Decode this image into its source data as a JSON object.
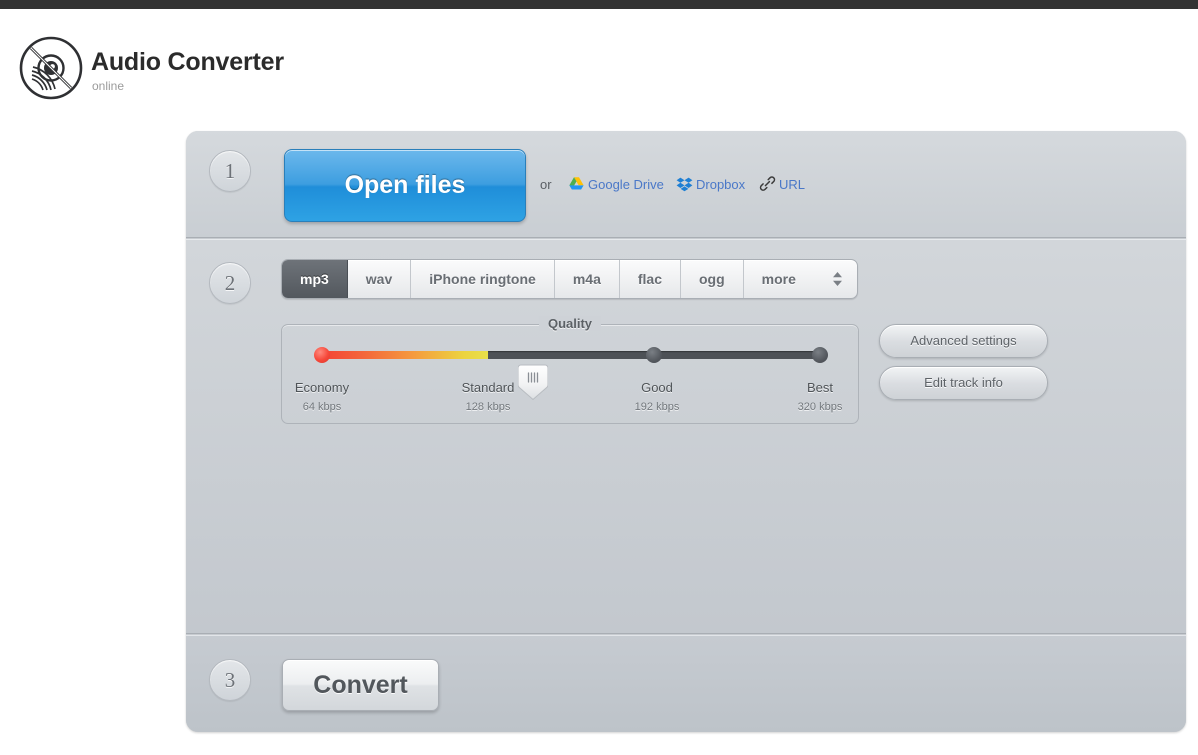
{
  "header": {
    "title": "Audio Converter",
    "subtitle": "online",
    "logo_icon": "vinyl-record-icon"
  },
  "steps": {
    "one": "1",
    "two": "2",
    "three": "3"
  },
  "step1": {
    "open_files_label": "Open files",
    "or_label": "or",
    "sources": [
      {
        "label": "Google Drive",
        "icon": "google-drive-icon"
      },
      {
        "label": "Dropbox",
        "icon": "dropbox-icon"
      },
      {
        "label": "URL",
        "icon": "link-chain-icon"
      }
    ]
  },
  "step2": {
    "formats": [
      {
        "label": "mp3",
        "active": true
      },
      {
        "label": "wav",
        "active": false
      },
      {
        "label": "iPhone ringtone",
        "active": false
      },
      {
        "label": "m4a",
        "active": false
      },
      {
        "label": "flac",
        "active": false
      },
      {
        "label": "ogg",
        "active": false
      }
    ],
    "more_label": "more",
    "more_icon": "chevron-up-down-icon",
    "quality": {
      "legend": "Quality",
      "selected": "Standard",
      "stops": [
        {
          "label": "Economy",
          "bitrate": "64 kbps"
        },
        {
          "label": "Standard",
          "bitrate": "128 kbps"
        },
        {
          "label": "Good",
          "bitrate": "192 kbps"
        },
        {
          "label": "Best",
          "bitrate": "320 kbps"
        }
      ]
    },
    "advanced_settings_label": "Advanced settings",
    "edit_track_info_label": "Edit track info"
  },
  "step3": {
    "convert_label": "Convert"
  },
  "colors": {
    "accent_blue": "#2e9ee0",
    "link_blue": "#4a78c8",
    "panel_bg": "#c7cbd0",
    "topbar": "#333333",
    "quality_low": "#f44336",
    "quality_high": "#e8e04a"
  }
}
